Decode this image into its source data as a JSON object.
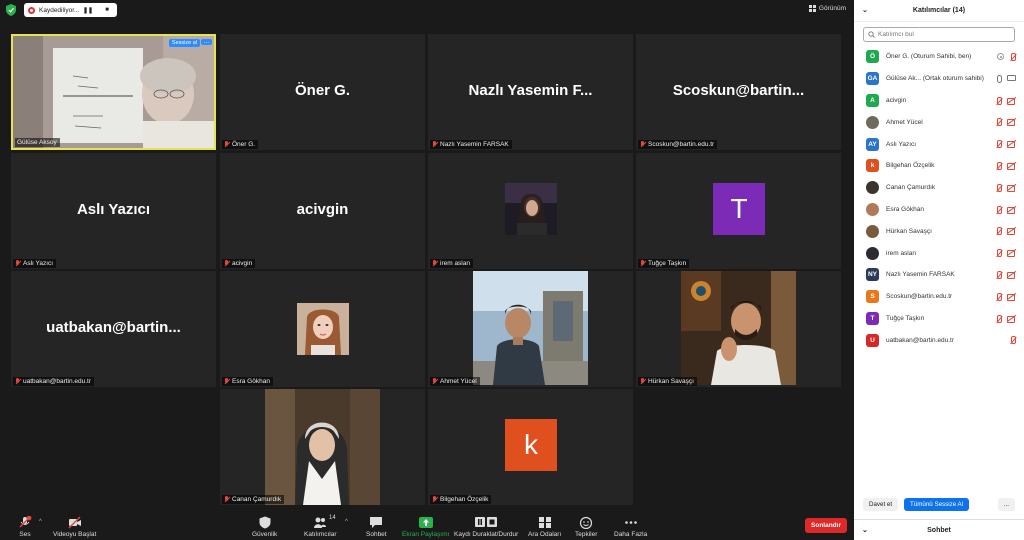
{
  "topbar": {
    "recording_label": "Kaydediliyor...",
    "view_label": "Görünüm"
  },
  "tiles": [
    {
      "name": "Gülüse Aksoy",
      "big": "",
      "type": "video-whiteboard",
      "mute_label": "Sessize al",
      "more_label": "..."
    },
    {
      "name": "Öner G.",
      "big": "Öner G.",
      "type": "name"
    },
    {
      "name": "Nazlı Yasemin FARSAK",
      "big": "Nazlı Yasemin F...",
      "type": "name"
    },
    {
      "name": "Scoskun@bartin.edu.tr",
      "big": "Scoskun@bartin...",
      "type": "name"
    },
    {
      "name": "Aslı Yazıcı",
      "big": "Aslı Yazıcı",
      "type": "name"
    },
    {
      "name": "acivgin",
      "big": "acivgin",
      "type": "name"
    },
    {
      "name": "irem aslan",
      "big": "",
      "type": "photo-small"
    },
    {
      "name": "Tuğçe Taşkın",
      "big": "",
      "type": "letter",
      "letter": "T",
      "color": "#7b2bb5"
    },
    {
      "name": "uatbakan@bartin.edu.tr",
      "big": "uatbakan@bartin...",
      "type": "name"
    },
    {
      "name": "Esra Gökhan",
      "big": "",
      "type": "photo-small"
    },
    {
      "name": "Ahmet Yücel",
      "big": "",
      "type": "photo-large"
    },
    {
      "name": "Hürkan Savaşçı",
      "big": "",
      "type": "photo-large"
    },
    {
      "name": "Canan Çamurdık",
      "big": "",
      "type": "photo-large"
    },
    {
      "name": "Bilgehan Özçelik",
      "big": "",
      "type": "letter",
      "letter": "k",
      "color": "#e0501e"
    }
  ],
  "toolbar": {
    "audio": "Ses",
    "video": "Videoyu Başlat",
    "security": "Güvenlik",
    "participants": "Katılımcılar",
    "participants_count": "14",
    "chat": "Sohbet",
    "share": "Ekran Paylaşımı",
    "record": "Kaydı Duraklat/Durdur",
    "breakout": "Ara Odaları",
    "reactions": "Tepkiler",
    "more": "Daha Fazla",
    "end": "Sonlandır"
  },
  "panel": {
    "title": "Katılımcılar (14)",
    "search_placeholder": "Katılımcı bul",
    "participants": [
      {
        "initials": "Ö",
        "name": "Öner G. (Oturum Sahibi, ben)",
        "color": "#1fa84f",
        "status": "host"
      },
      {
        "initials": "GA",
        "name": "Gülüse Ak...  (Ortak oturum sahibi)",
        "color": "#2a74c9",
        "status": "cohost"
      },
      {
        "initials": "A",
        "name": "acivgin",
        "color": "#1fa84f",
        "status": "muted"
      },
      {
        "initials": "",
        "name": "Ahmet Yücel",
        "color": "#6f6a5e",
        "status": "muted"
      },
      {
        "initials": "AY",
        "name": "Aslı Yazıcı",
        "color": "#2a74c9",
        "status": "muted"
      },
      {
        "initials": "k",
        "name": "Bilgehan Özçelik",
        "color": "#e0501e",
        "status": "muted"
      },
      {
        "initials": "",
        "name": "Canan Çamurdık",
        "color": "#3b332c",
        "status": "muted"
      },
      {
        "initials": "",
        "name": "Esra Gökhan",
        "color": "#b07a5a",
        "status": "muted"
      },
      {
        "initials": "",
        "name": "Hürkan Savaşçı",
        "color": "#7a5a3d",
        "status": "muted"
      },
      {
        "initials": "",
        "name": "irem aslan",
        "color": "#2e2a33",
        "status": "muted"
      },
      {
        "initials": "NY",
        "name": "Nazlı Yasemin FARSAK",
        "color": "#2a3a5a",
        "status": "muted"
      },
      {
        "initials": "S",
        "name": "Scoskun@bartin.edu.tr",
        "color": "#e8781e",
        "status": "muted"
      },
      {
        "initials": "T",
        "name": "Tuğçe Taşkın",
        "color": "#7b2bb5",
        "status": "muted"
      },
      {
        "initials": "U",
        "name": "uatbakan@bartin.edu.tr",
        "color": "#d62828",
        "status": "mic-only"
      }
    ],
    "invite_label": "Davet et",
    "mute_all_label": "Tümünü Sessize Al",
    "more_label": "...",
    "chat_label": "Sohbet"
  }
}
